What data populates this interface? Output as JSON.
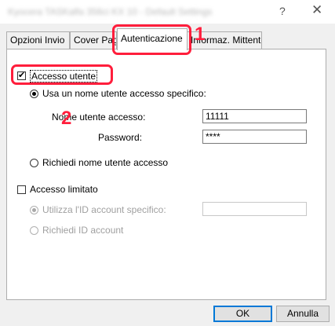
{
  "window": {
    "title": "Kyocera TASKalfa 356ci KX 10 - Default Settings",
    "help_glyph": "?",
    "close_glyph": "✕"
  },
  "tabs": [
    {
      "label": "Opzioni Invio"
    },
    {
      "label": "Cover Pag"
    },
    {
      "label": "Autenticazione",
      "active": true
    },
    {
      "label": "Informaz. Mittente"
    }
  ],
  "auth": {
    "accesso_utente": {
      "label": "Accesso utente",
      "checked": true
    },
    "usa_nome": {
      "label": "Usa un nome utente accesso specifico:",
      "selected": true
    },
    "nome_utente": {
      "label": "Nome utente accesso:",
      "value": "11111"
    },
    "password": {
      "label": "Password:",
      "value": "****"
    },
    "richiedi_nome": {
      "label": "Richiedi nome utente accesso",
      "selected": false
    }
  },
  "account": {
    "accesso_limitato": {
      "label": "Accesso limitato",
      "checked": false
    },
    "utilizza_id": {
      "label": "Utilizza l'ID account specifico:",
      "selected": true,
      "enabled": false
    },
    "id_value": "",
    "richiedi_id": {
      "label": "Richiedi ID account",
      "selected": false,
      "enabled": false
    }
  },
  "annotations": {
    "step1": "1",
    "step2": "2",
    "color": "#ff1e3c"
  },
  "buttons": {
    "ok": "OK",
    "cancel": "Annulla"
  }
}
